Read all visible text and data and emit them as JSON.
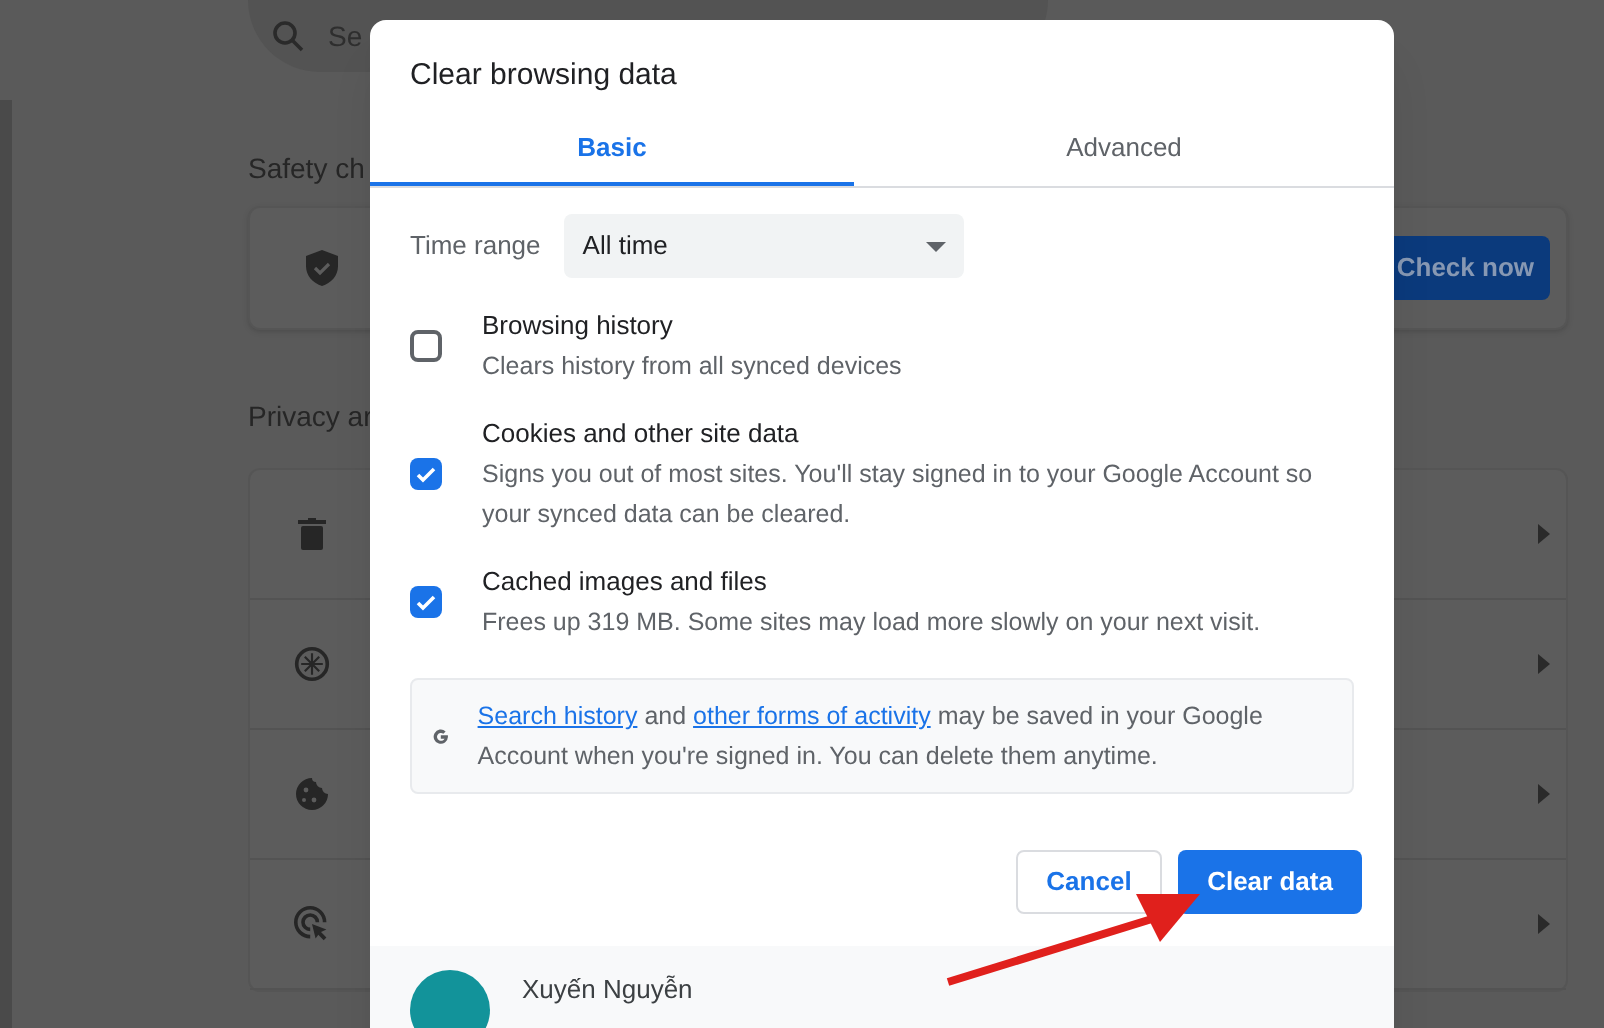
{
  "background": {
    "search": {
      "placeholder": "Se"
    },
    "safety_heading": "Safety ch",
    "safety_card": {
      "button": "Check now"
    },
    "privacy_heading": "Privacy ar",
    "privacy_rows": [
      {
        "kind": "trash"
      },
      {
        "kind": "compass"
      },
      {
        "kind": "cookie"
      },
      {
        "kind": "target"
      }
    ]
  },
  "dialog": {
    "title": "Clear browsing data",
    "tabs": [
      {
        "label": "Basic",
        "selected": true
      },
      {
        "label": "Advanced",
        "selected": false
      }
    ],
    "time_range": {
      "label": "Time range",
      "value": "All time"
    },
    "options": [
      {
        "label": "Browsing history",
        "description": "Clears history from all synced devices",
        "checked": false
      },
      {
        "label": "Cookies and other site data",
        "description": "Signs you out of most sites. You'll stay signed in to your Google Account so your synced data can be cleared.",
        "checked": true
      },
      {
        "label": "Cached images and files",
        "description": "Frees up 319 MB. Some sites may load more slowly on your next visit.",
        "checked": true
      }
    ],
    "info": {
      "link_1": "Search history",
      "text_1": "and",
      "link_2": "other forms of activity",
      "text_2": "may be saved in your Google Account when you're signed in. You can delete them anytime."
    },
    "buttons": {
      "cancel": "Cancel",
      "confirm": "Clear data"
    },
    "account": {
      "name": "Xuyến Nguyễn"
    }
  }
}
